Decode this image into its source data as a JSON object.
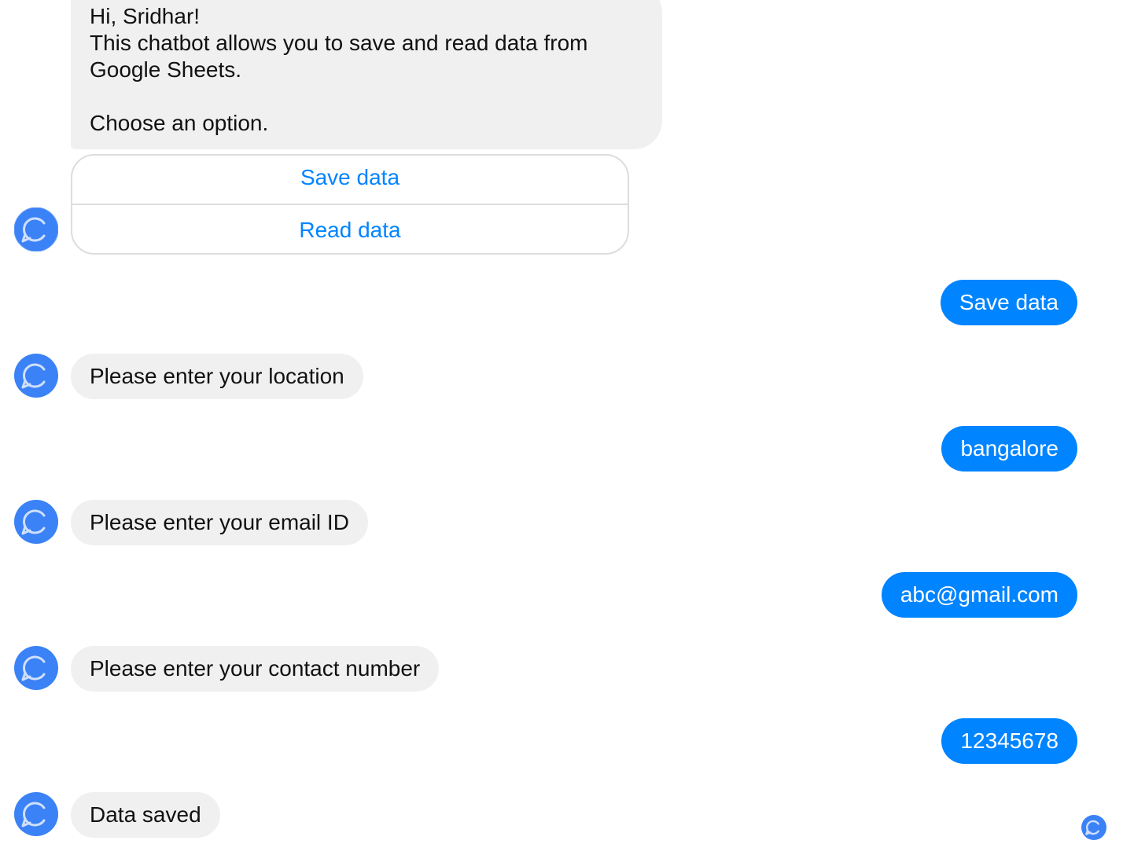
{
  "intro_message": {
    "lines": [
      "Hi, Sridhar!",
      "This chatbot allows you to save and read data from",
      "Google Sheets.",
      "",
      "Choose an option."
    ]
  },
  "quick_replies": [
    {
      "label": "Save data"
    },
    {
      "label": "Read data"
    }
  ],
  "conversation": [
    {
      "sender": "user",
      "text": "Save data"
    },
    {
      "sender": "bot",
      "text": "Please enter your location"
    },
    {
      "sender": "user",
      "text": "bangalore"
    },
    {
      "sender": "bot",
      "text": "Please enter your email ID"
    },
    {
      "sender": "user",
      "text": "abc@gmail.com"
    },
    {
      "sender": "bot",
      "text": "Please enter your contact number"
    },
    {
      "sender": "user",
      "text": "12345678"
    },
    {
      "sender": "bot",
      "text": "Data saved"
    }
  ],
  "colors": {
    "user_bubble": "#0084ff",
    "bot_bubble": "#f0f0f0",
    "link": "#0084ff",
    "avatar": "#3b82f6"
  },
  "icons": {
    "bot_avatar": "chat-bubble-icon",
    "read_receipt": "chat-bubble-icon"
  }
}
